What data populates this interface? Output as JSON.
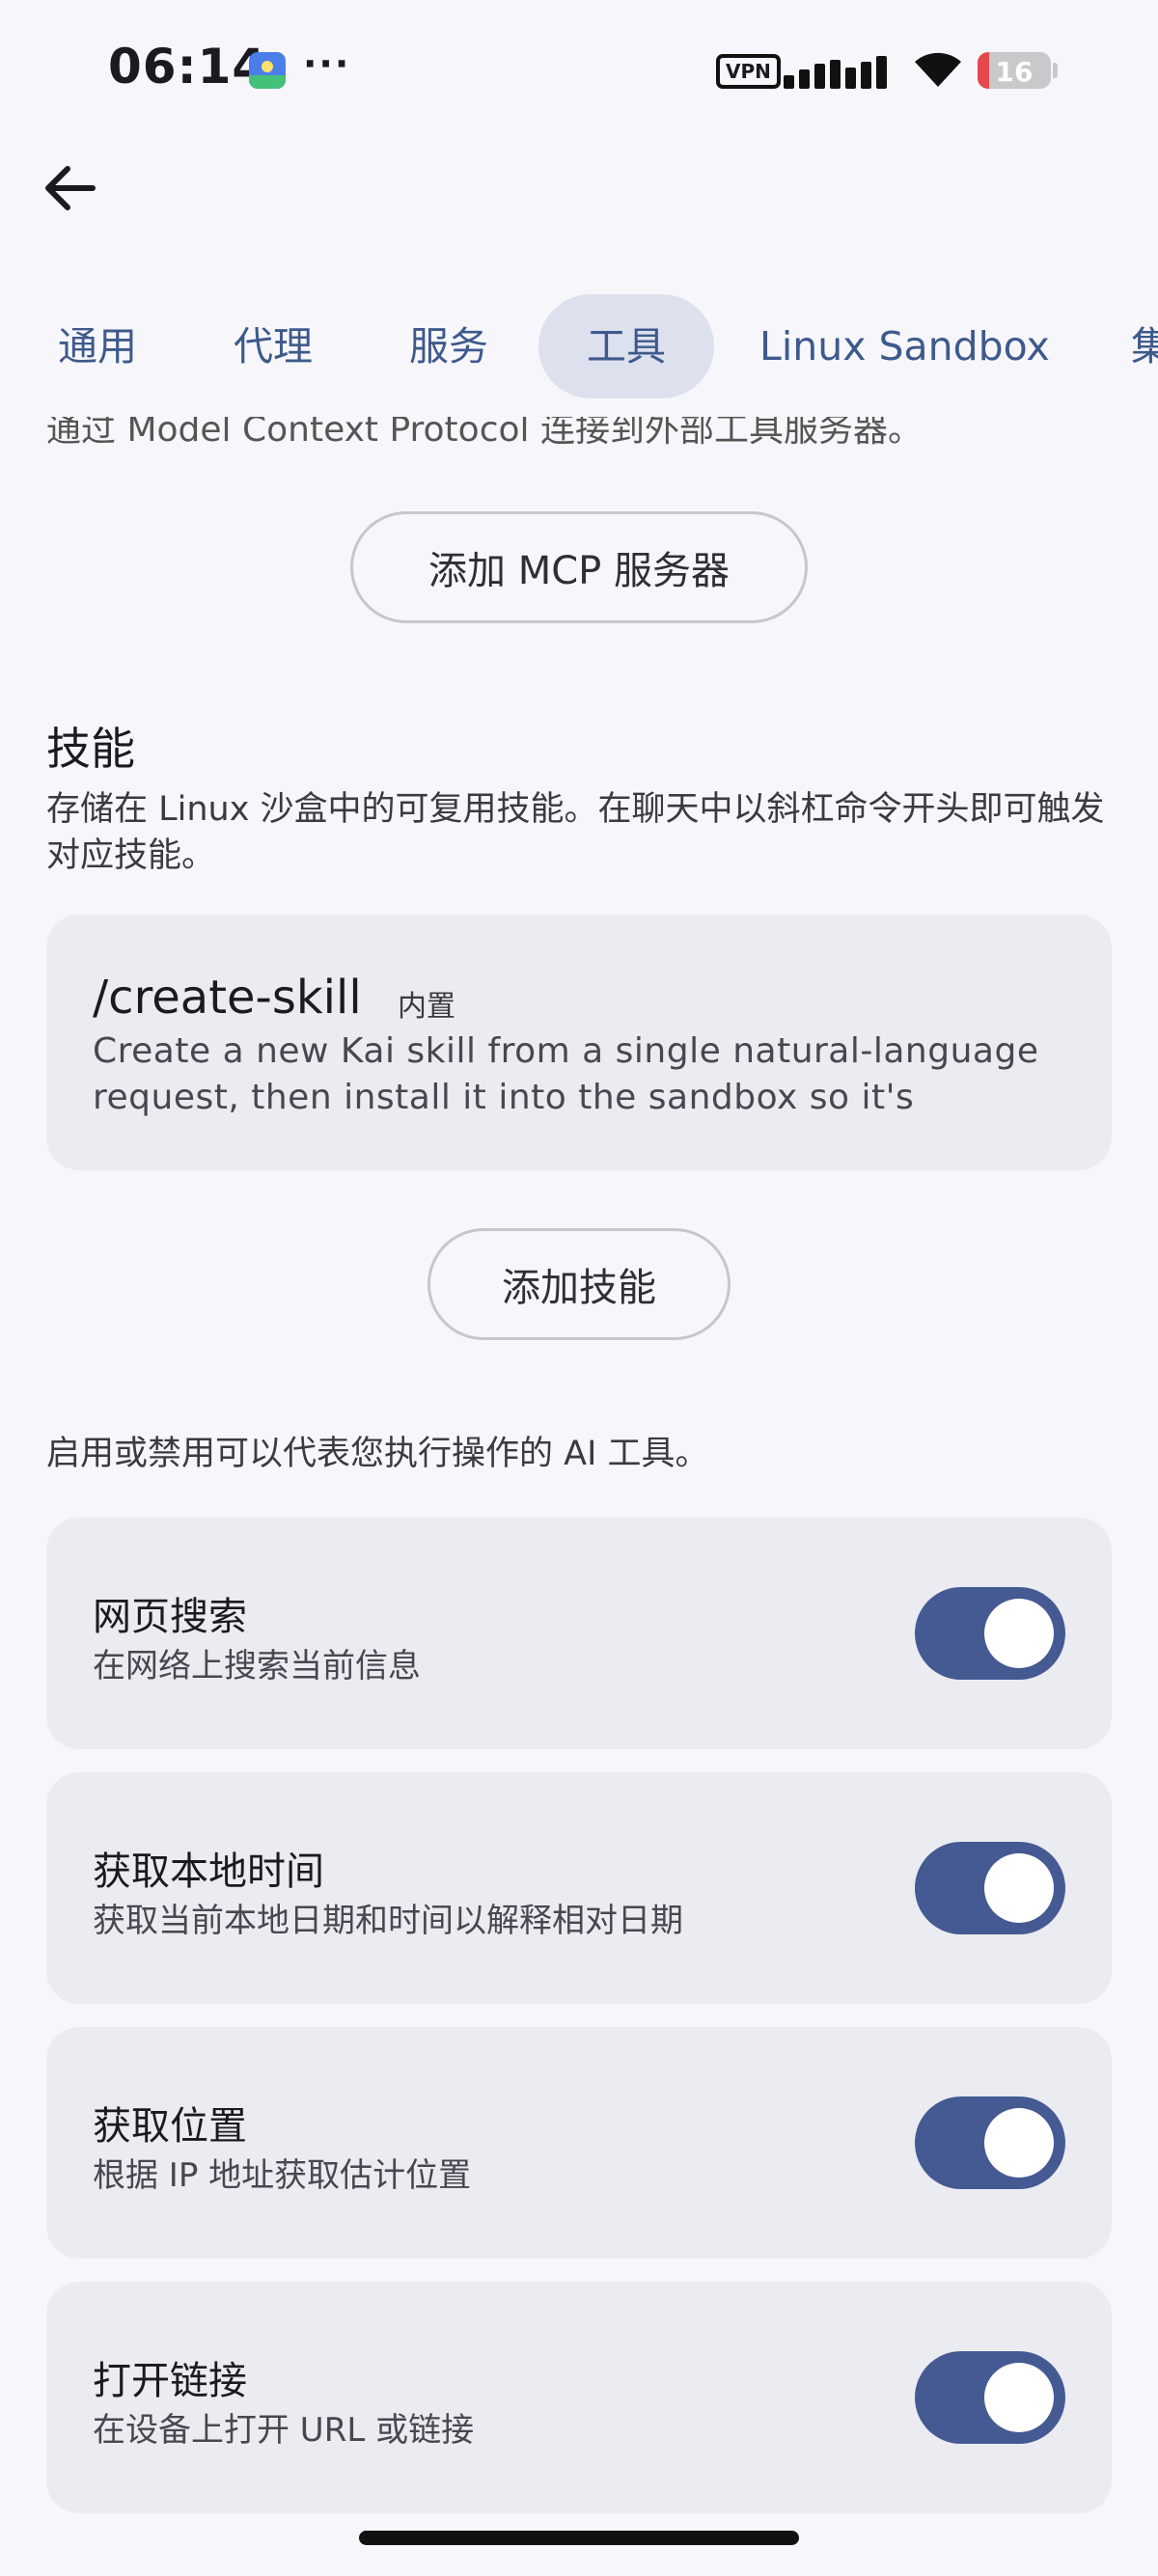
{
  "status_bar": {
    "time": "06:14",
    "overflow": "···",
    "vpn": "VPN",
    "battery_level": "16",
    "battery_fraction": 0.16
  },
  "tabs": [
    {
      "label": "通用",
      "selected": false
    },
    {
      "label": "代理",
      "selected": false
    },
    {
      "label": "服务",
      "selected": false
    },
    {
      "label": "工具",
      "selected": true
    },
    {
      "label": "Linux Sandbox",
      "selected": false
    },
    {
      "label": "集",
      "selected": false
    }
  ],
  "mcp": {
    "description": "通过 Model Context Protocol 连接到外部工具服务器。",
    "add_button": "添加 MCP 服务器"
  },
  "skills": {
    "title": "技能",
    "description": "存储在 Linux 沙盒中的可复用技能。在聊天中以斜杠命令开头即可触发对应技能。",
    "items": [
      {
        "name": "/create-skill",
        "badge": "内置",
        "description": "Create a new Kai skill from a single natural-language request, then install it into the sandbox so it's"
      }
    ],
    "add_button": "添加技能"
  },
  "tools": {
    "description": "启用或禁用可以代表您执行操作的 AI 工具。",
    "items": [
      {
        "title": "网页搜索",
        "subtitle": "在网络上搜索当前信息",
        "enabled": true
      },
      {
        "title": "获取本地时间",
        "subtitle": "获取当前本地日期和时间以解释相对日期",
        "enabled": true
      },
      {
        "title": "获取位置",
        "subtitle": "根据 IP 地址获取估计位置",
        "enabled": true
      },
      {
        "title": "打开链接",
        "subtitle": "在设备上打开 URL 或链接",
        "enabled": true
      }
    ]
  },
  "colors": {
    "accent": "#455a92",
    "tab_text": "#3e5a8c",
    "selected_tab_bg": "#dde1ee",
    "card_bg": "#ebebf2",
    "page_bg": "#f7f7fb",
    "battery_low": "#e5484d"
  },
  "icons": {
    "back": "arrow-left-icon",
    "wifi": "wifi-icon",
    "signal": "signal-icon",
    "battery": "battery-icon",
    "app": "app-notification-icon"
  }
}
